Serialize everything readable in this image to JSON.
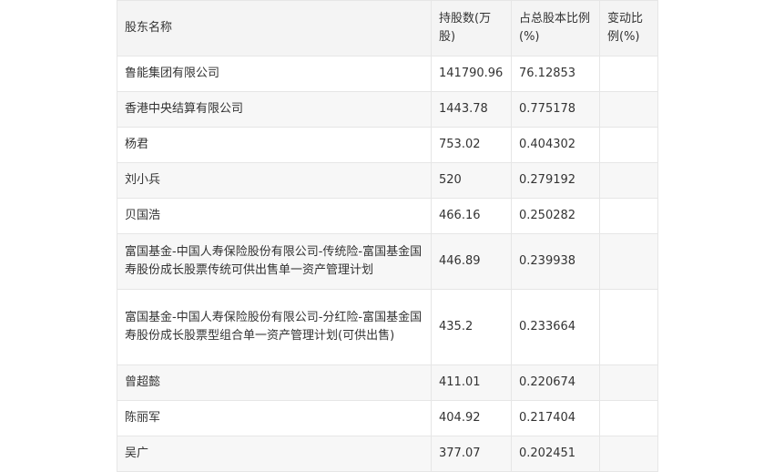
{
  "table": {
    "headers": {
      "name": "股东名称",
      "shares": "持股数(万股)",
      "pct": "占总股本比例(%)",
      "change": "变动比例(%)"
    },
    "rows": [
      {
        "name": "鲁能集团有限公司",
        "shares": "141790.96",
        "pct": "76.12853",
        "change": ""
      },
      {
        "name": "香港中央结算有限公司",
        "shares": "1443.78",
        "pct": "0.775178",
        "change": ""
      },
      {
        "name": "杨君",
        "shares": "753.02",
        "pct": "0.404302",
        "change": ""
      },
      {
        "name": "刘小兵",
        "shares": "520",
        "pct": "0.279192",
        "change": ""
      },
      {
        "name": "贝国浩",
        "shares": "466.16",
        "pct": "0.250282",
        "change": ""
      },
      {
        "name": "富国基金-中国人寿保险股份有限公司-传统险-富国基金国寿股份成长股票传统可供出售单一资产管理计划",
        "shares": "446.89",
        "pct": "0.239938",
        "change": ""
      },
      {
        "name": "富国基金-中国人寿保险股份有限公司-分红险-富国基金国寿股份成长股票型组合单一资产管理计划(可供出售)",
        "shares": "435.2",
        "pct": "0.233664",
        "change": ""
      },
      {
        "name": "曾超懿",
        "shares": "411.01",
        "pct": "0.220674",
        "change": ""
      },
      {
        "name": "陈丽军",
        "shares": "404.92",
        "pct": "0.217404",
        "change": ""
      },
      {
        "name": "吴广",
        "shares": "377.07",
        "pct": "0.202451",
        "change": ""
      }
    ]
  }
}
